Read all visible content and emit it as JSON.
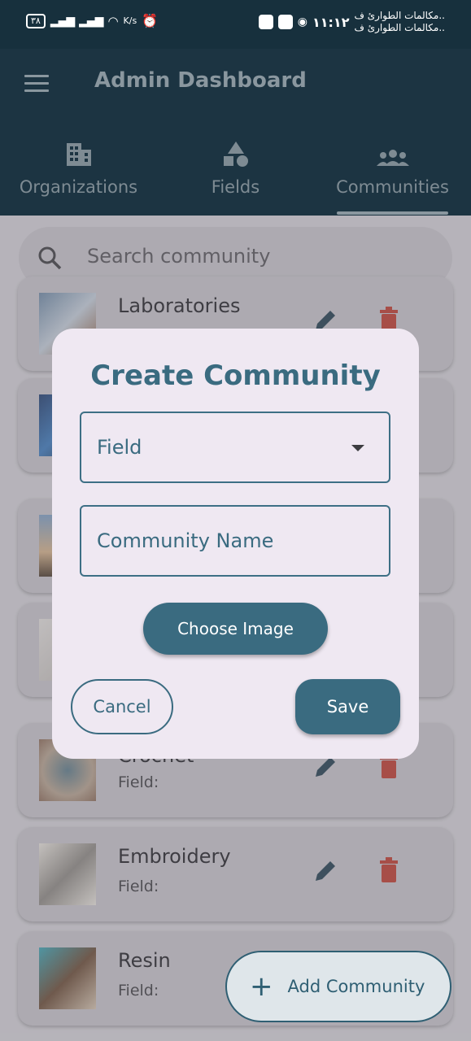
{
  "status_bar": {
    "battery": "٣٨",
    "speed_unit": "K/s",
    "time": "١١:١٢",
    "notification_lines": [
      "مكالمات الطوارئ ف..",
      "مكالمات الطوارئ ف.."
    ]
  },
  "app_bar": {
    "title": "Admin Dashboard",
    "tabs": [
      {
        "label": "Organizations",
        "icon": "building-icon",
        "selected": false
      },
      {
        "label": "Fields",
        "icon": "shapes-icon",
        "selected": false
      },
      {
        "label": "Communities",
        "icon": "people-icon",
        "selected": true
      }
    ]
  },
  "search": {
    "placeholder": "Search community"
  },
  "communities": [
    {
      "name": "Laboratories",
      "field": ""
    },
    {
      "name": "",
      "field": ""
    },
    {
      "name": "",
      "field": ""
    },
    {
      "name": "",
      "field": ""
    },
    {
      "name": "Crochet",
      "field": "Field:"
    },
    {
      "name": "Embroidery",
      "field": "Field:"
    },
    {
      "name": "Resin",
      "field": "Field:"
    }
  ],
  "fab": {
    "label": "Add Community"
  },
  "dialog": {
    "title": "Create Community",
    "field_dropdown_label": "Field",
    "community_name_label": "Community Name",
    "choose_image_label": "Choose Image",
    "cancel_label": "Cancel",
    "save_label": "Save"
  },
  "colors": {
    "primary": "#3a6b80",
    "appbar": "#1c3442",
    "dialog_bg": "#efe8f2",
    "delete": "#c0392b"
  }
}
